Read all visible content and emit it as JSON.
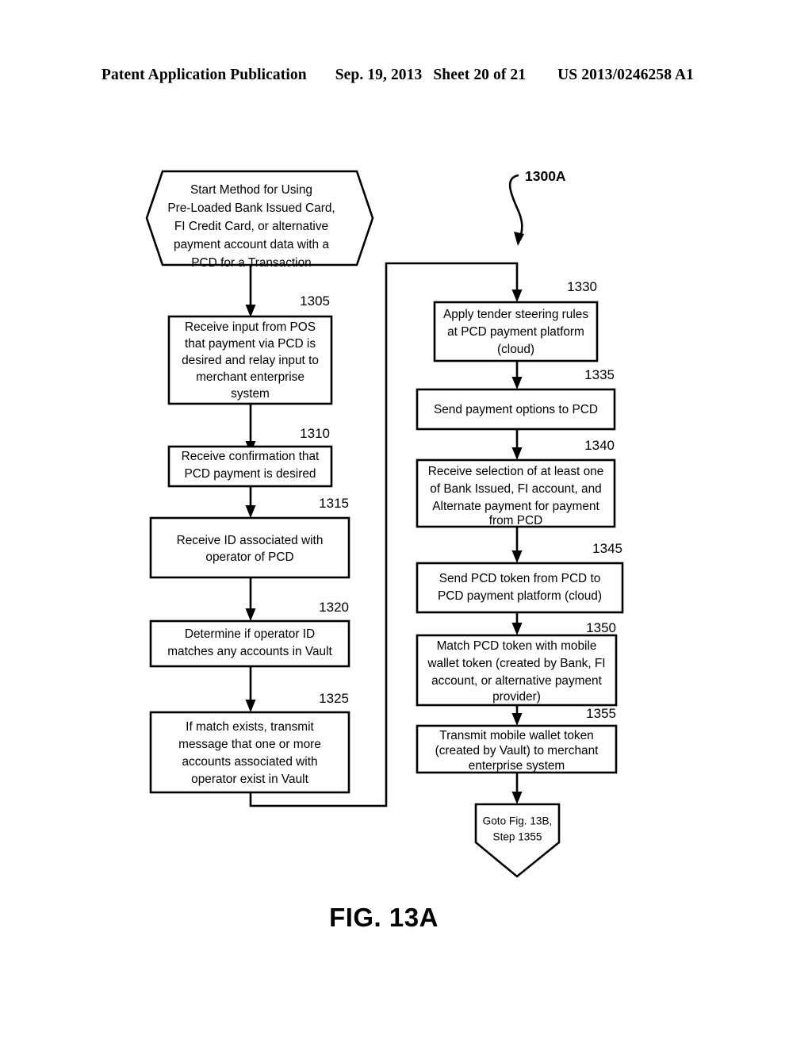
{
  "header": {
    "publication": "Patent Application Publication",
    "date": "Sep. 19, 2013",
    "sheet": "Sheet 20 of 21",
    "pub_number": "US 2013/0246258 A1"
  },
  "figure": {
    "label": "FIG. 13A",
    "diagram_ref": "1300A"
  },
  "nodes": {
    "start": {
      "ref": "",
      "lines": [
        "Start Method for Using",
        "Pre-Loaded Bank Issued Card,",
        "FI Credit Card, or alternative",
        "payment account data with a",
        "PCD for a Transaction"
      ]
    },
    "n1305": {
      "ref": "1305",
      "lines": [
        "Receive input from POS",
        "that payment via PCD is",
        "desired and relay input to",
        "merchant enterprise",
        "system"
      ]
    },
    "n1310": {
      "ref": "1310",
      "lines": [
        "Receive confirmation that",
        "PCD payment is desired"
      ]
    },
    "n1315": {
      "ref": "1315",
      "lines": [
        "Receive ID associated with",
        "operator of PCD"
      ]
    },
    "n1320": {
      "ref": "1320",
      "lines": [
        "Determine if operator ID",
        "matches any accounts in Vault"
      ]
    },
    "n1325": {
      "ref": "1325",
      "lines": [
        "If match exists, transmit",
        "message that one or more",
        "accounts associated with",
        "operator exist in Vault"
      ]
    },
    "n1330": {
      "ref": "1330",
      "lines": [
        "Apply tender steering rules",
        "at PCD payment platform",
        "(cloud)"
      ]
    },
    "n1335": {
      "ref": "1335",
      "lines": [
        "Send payment options to PCD"
      ]
    },
    "n1340": {
      "ref": "1340",
      "lines": [
        "Receive selection of at least one",
        "of Bank Issued, FI account, and",
        "Alternate payment for payment",
        "from PCD"
      ]
    },
    "n1345": {
      "ref": "1345",
      "lines": [
        "Send PCD token from PCD to",
        "PCD payment platform (cloud)"
      ]
    },
    "n1350": {
      "ref": "1350",
      "lines": [
        "Match PCD token with mobile",
        "wallet token (created by Bank, FI",
        "account, or alternative payment",
        "provider)"
      ]
    },
    "n1355": {
      "ref": "1355",
      "lines": [
        "Transmit mobile wallet token",
        "(created by Vault) to merchant",
        "enterprise system"
      ]
    },
    "goto": {
      "ref": "",
      "lines": [
        "Goto Fig. 13B,",
        "Step 1355"
      ]
    }
  }
}
